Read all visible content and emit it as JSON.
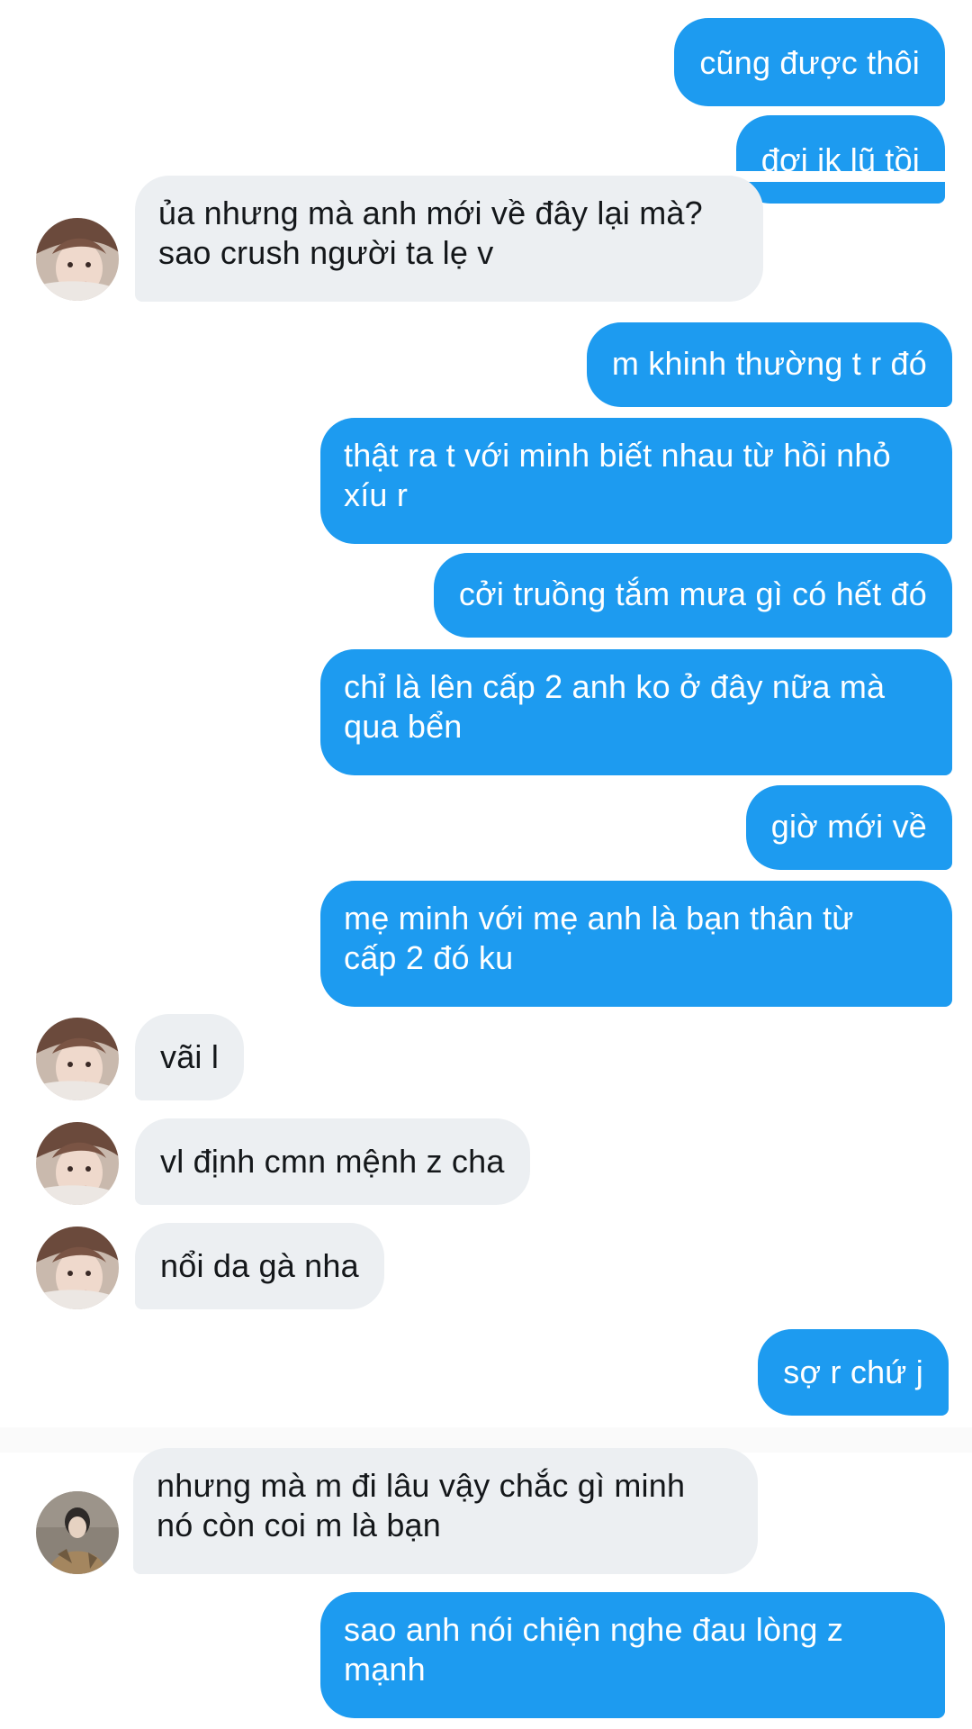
{
  "messages": [
    {
      "side": "out",
      "text": "cũng được thôi"
    },
    {
      "side": "out",
      "text": "đợi ik lũ tồi"
    },
    {
      "side": "in",
      "avatar": "avatar-1",
      "text": "ủa nhưng mà anh mới về đây lại mà?\nsao crush người ta lẹ v"
    },
    {
      "side": "out",
      "text": "m khinh thường t r đó"
    },
    {
      "side": "out",
      "text": "thật ra t với minh biết nhau từ hồi nhỏ\nxíu r"
    },
    {
      "side": "out",
      "text": "cởi truồng tắm mưa gì có hết đó"
    },
    {
      "side": "out",
      "text": "chỉ là lên cấp 2 anh ko ở đây nữa mà\nqua bển"
    },
    {
      "side": "out",
      "text": "giờ mới về"
    },
    {
      "side": "out",
      "text": "mẹ minh với mẹ anh là bạn thân từ\ncấp 2 đó ku"
    },
    {
      "side": "in",
      "avatar": "avatar-1",
      "text": "vãi l"
    },
    {
      "side": "in",
      "avatar": "avatar-1",
      "text": "vl định cmn mệnh z cha"
    },
    {
      "side": "in",
      "avatar": "avatar-1",
      "text": "nổi da gà nha"
    },
    {
      "side": "out",
      "text": "sợ r chứ j"
    },
    {
      "side": "in",
      "avatar": "avatar-2",
      "text": "nhưng mà m đi lâu vậy chắc gì minh\nnó còn coi m là bạn"
    },
    {
      "side": "out",
      "text": "sao anh nói chiện nghe đau lòng z\nmạnh"
    }
  ],
  "colors": {
    "outgoing_bubble": "#1d9bf0",
    "incoming_bubble": "#eceff2",
    "outgoing_text": "#ffffff",
    "incoming_text": "#14171a"
  }
}
